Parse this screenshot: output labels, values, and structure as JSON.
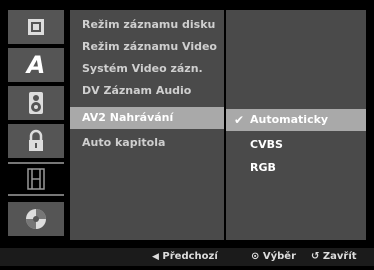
{
  "left_icons": [
    {
      "icon": "disc-icon",
      "label": ""
    },
    {
      "icon": "letter-a-icon",
      "label": "A"
    },
    {
      "icon": "speaker-icon",
      "label": ""
    },
    {
      "icon": "lock-icon",
      "label": ""
    },
    {
      "icon": "film-icon",
      "label": ""
    },
    {
      "icon": "dvd-disc-icon",
      "label": ""
    }
  ],
  "menu": {
    "items": [
      {
        "label": "Režim záznamu disku"
      },
      {
        "label": "Režim záznamu Video"
      },
      {
        "label": "Systém Video zázn."
      },
      {
        "label": "DV Záznam Audio"
      },
      {
        "label": "AV2 Nahrávání"
      },
      {
        "label": "Auto kapitola"
      }
    ],
    "selected_index": 4
  },
  "options": {
    "items": [
      {
        "label": "Automaticky",
        "checked": true
      },
      {
        "label": "CVBS",
        "checked": false
      },
      {
        "label": "RGB",
        "checked": false
      }
    ]
  },
  "help": {
    "prev": {
      "symbol": "◀",
      "label": "Předchozí"
    },
    "select": {
      "symbol": "⊙",
      "label": "Výběr"
    },
    "close": {
      "symbol": "↺",
      "label": "Zavřít"
    }
  },
  "colors": {
    "panel": "#4a4a4a",
    "highlight": "#a9a9a9",
    "background": "#000000"
  }
}
